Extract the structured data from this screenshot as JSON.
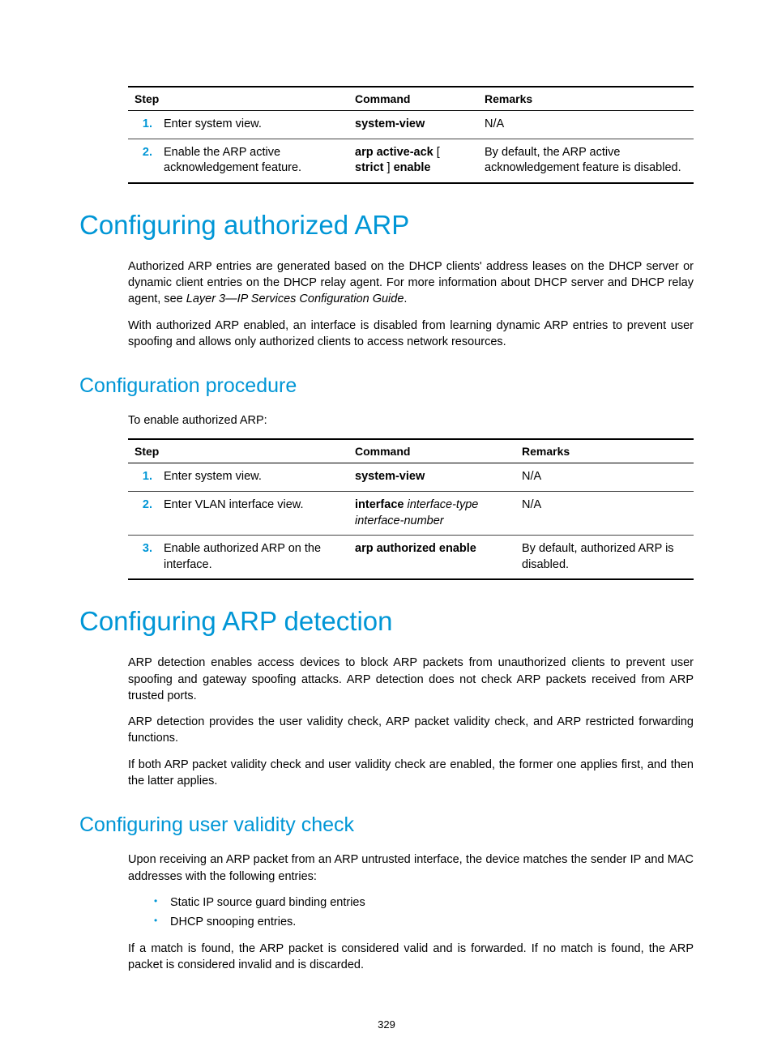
{
  "page_number": "329",
  "table1": {
    "headers": {
      "step": "Step",
      "command": "Command",
      "remarks": "Remarks"
    },
    "rows": [
      {
        "num": "1.",
        "step": "Enter system view.",
        "cmd_html": "<span class=\"bold\">system-view</span>",
        "remarks": "N/A"
      },
      {
        "num": "2.",
        "step": "Enable the ARP active acknowledgement feature.",
        "cmd_html": "<span class=\"bold\">arp active-ack</span> [ <span class=\"bold\">strict</span> ] <span class=\"bold\">enable</span>",
        "remarks": "By default, the ARP active acknowledgement feature is disabled."
      }
    ]
  },
  "section1": {
    "h1": "Configuring authorized ARP",
    "p1_html": "Authorized ARP entries are generated based on the DHCP clients' address leases on the DHCP server or dynamic client entries on the DHCP relay agent. For more information about DHCP server and DHCP relay agent, see <span class=\"italic\">Layer 3—IP Services Configuration Guide</span>.",
    "p2": "With authorized ARP enabled, an interface is disabled from learning dynamic ARP entries to prevent user spoofing and allows only authorized clients to access network resources.",
    "h2": "Configuration procedure",
    "p3": "To enable authorized ARP:"
  },
  "table2": {
    "headers": {
      "step": "Step",
      "command": "Command",
      "remarks": "Remarks"
    },
    "rows": [
      {
        "num": "1.",
        "step": "Enter system view.",
        "cmd_html": "<span class=\"bold\">system-view</span>",
        "remarks": "N/A"
      },
      {
        "num": "2.",
        "step": "Enter VLAN interface view.",
        "cmd_html": "<span class=\"bold\">interface</span> <span class=\"ital\">interface-type interface-number</span>",
        "remarks": "N/A"
      },
      {
        "num": "3.",
        "step": "Enable authorized ARP on the interface.",
        "cmd_html": "<span class=\"bold\">arp authorized enable</span>",
        "remarks": "By default, authorized ARP is disabled."
      }
    ]
  },
  "section2": {
    "h1": "Configuring ARP detection",
    "p1": "ARP detection enables access devices to block ARP packets from unauthorized clients to prevent user spoofing and gateway spoofing attacks. ARP detection does not check ARP packets received from ARP trusted ports.",
    "p2": "ARP detection provides the user validity check, ARP packet validity check, and ARP restricted forwarding functions.",
    "p3": "If both ARP packet validity check and user validity check are enabled, the former one applies first, and then the latter applies.",
    "h2": "Configuring user validity check",
    "p4": "Upon receiving an ARP packet from an ARP untrusted interface, the device matches the sender IP and MAC addresses with the following entries:",
    "bullets": [
      "Static IP source guard binding entries",
      "DHCP snooping entries."
    ],
    "p5": "If a match is found, the ARP packet is considered valid and is forwarded. If no match is found, the ARP packet is considered invalid and is discarded."
  }
}
